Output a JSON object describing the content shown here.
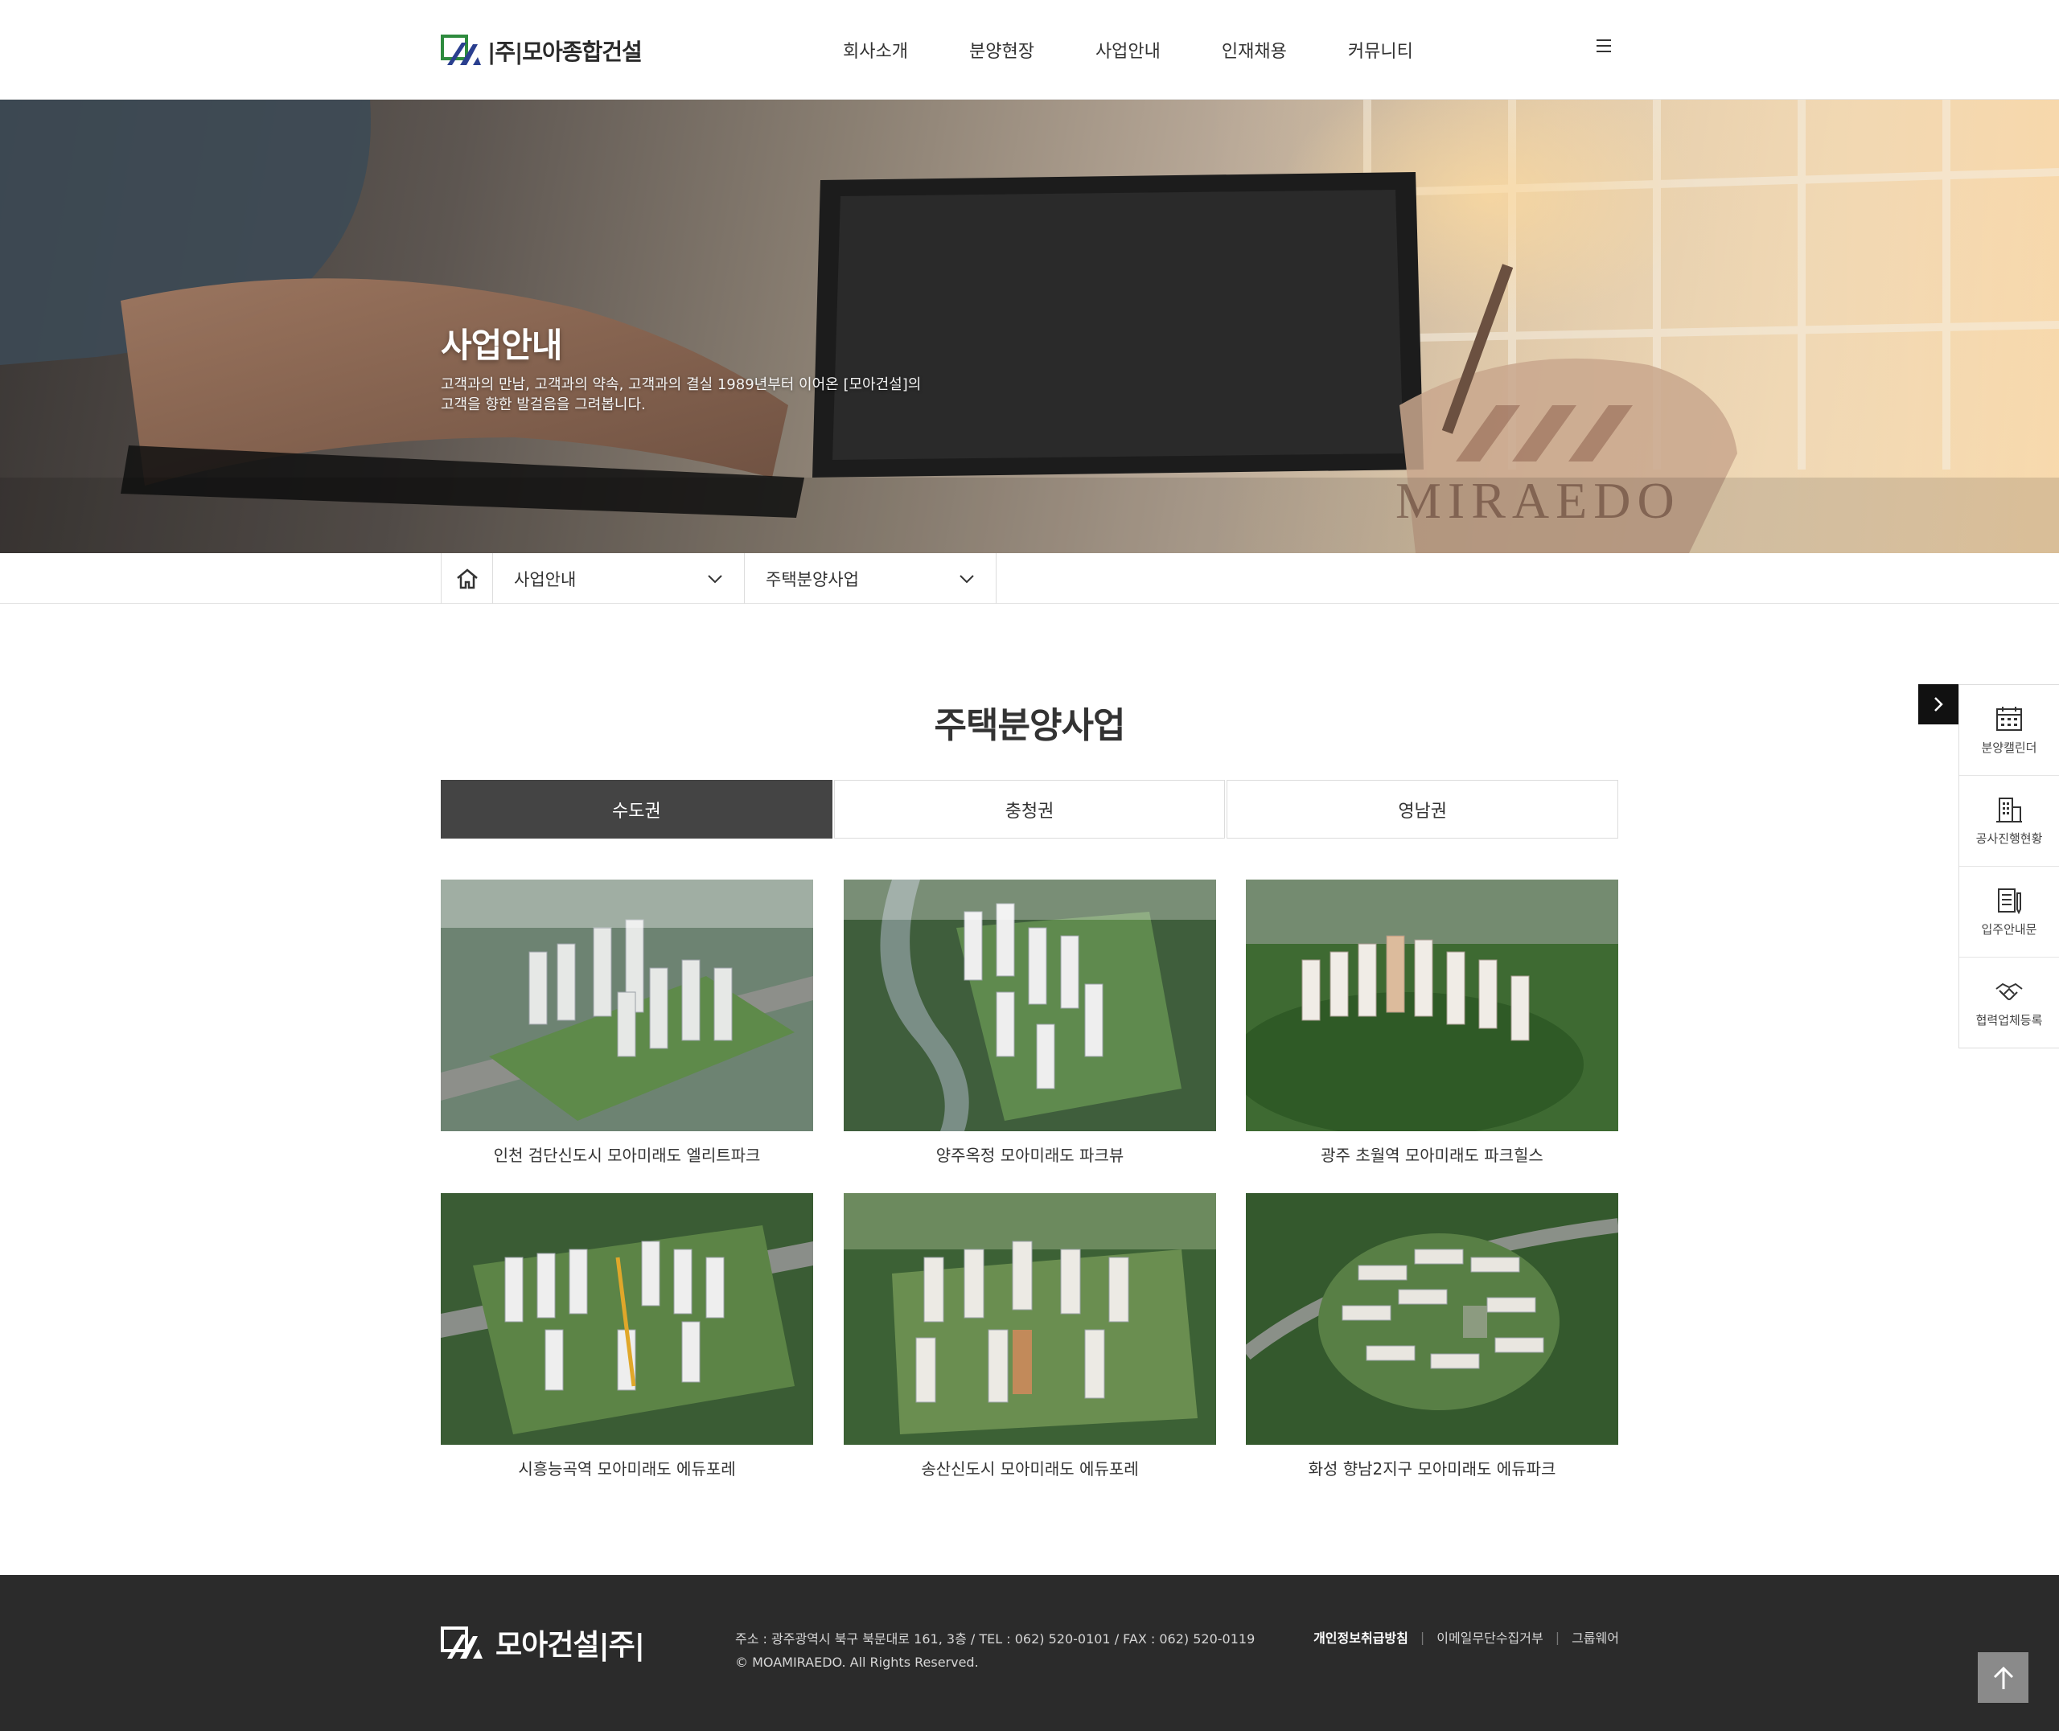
{
  "header": {
    "logo_text": "|주|모아종합건설",
    "nav": [
      "회사소개",
      "분양현장",
      "사업안내",
      "인재채용",
      "커뮤니티"
    ]
  },
  "hero": {
    "title": "사업안내",
    "desc_line1": "고객과의 만남, 고객과의 약속, 고객과의 결실 1989년부터 이어온 [모아건설]의",
    "desc_line2": "고객을 향한 발걸음을 그려봅니다.",
    "watermark": "MIRAEDO"
  },
  "breadcrumb": {
    "select1": "사업안내",
    "select2": "주택분양사업"
  },
  "page_title": "주택분양사업",
  "tabs": [
    "수도권",
    "충청권",
    "영남권"
  ],
  "active_tab": 0,
  "projects": [
    "인천 검단신도시 모아미래도 엘리트파크",
    "양주옥정 모아미래도 파크뷰",
    "광주 초월역 모아미래도 파크힐스",
    "시흥능곡역 모아미래도 에듀포레",
    "송산신도시 모아미래도 에듀포레",
    "화성 향남2지구 모아미래도 에듀파크"
  ],
  "quick_menu": [
    "분양캘린더",
    "공사진행현황",
    "입주안내문",
    "협력업체등록"
  ],
  "footer": {
    "logo_text": "모아건설|주|",
    "address": "주소 : 광주광역시 북구 북문대로 161, 3층 / TEL : 062) 520-0101 / FAX : 062) 520-0119",
    "copyright": "© MOAMIRAEDO. All Rights Reserved.",
    "links": [
      "개인정보취급방침",
      "이메일무단수집거부",
      "그룹웨어"
    ]
  },
  "colors": {
    "active_tab_bg": "#444444",
    "footer_bg": "#2b2b2b",
    "logo_green": "#2e8b3e",
    "logo_blue": "#2a3f8f"
  }
}
